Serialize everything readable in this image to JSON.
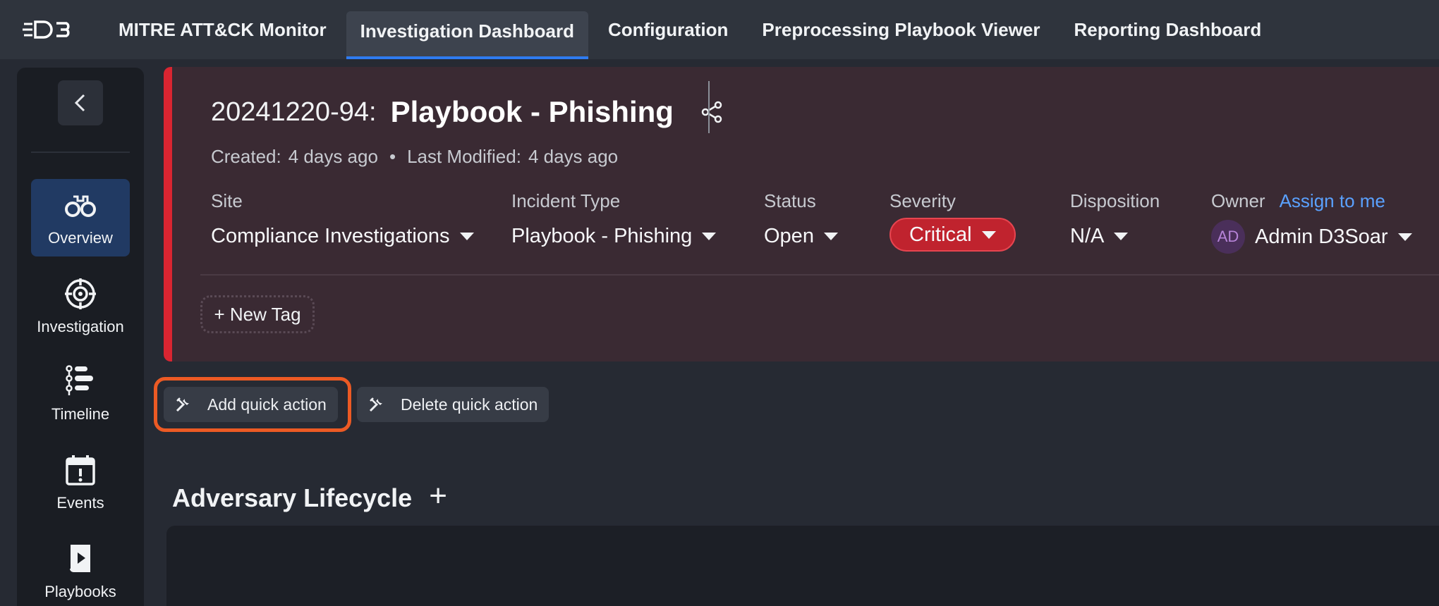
{
  "brand": {
    "logo_text": "D3"
  },
  "nav": {
    "tabs": [
      {
        "label": "MITRE ATT&CK Monitor"
      },
      {
        "label": "Investigation Dashboard",
        "active": true
      },
      {
        "label": "Configuration"
      },
      {
        "label": "Preprocessing Playbook Viewer"
      },
      {
        "label": "Reporting Dashboard"
      }
    ]
  },
  "sidebar": {
    "items": [
      {
        "label": "Overview",
        "icon": "binoculars-icon",
        "active": true
      },
      {
        "label": "Investigation",
        "icon": "crosshair-icon"
      },
      {
        "label": "Timeline",
        "icon": "timeline-icon"
      },
      {
        "label": "Events",
        "icon": "calendar-alert-icon"
      },
      {
        "label": "Playbooks",
        "icon": "playbook-icon"
      }
    ]
  },
  "incident": {
    "id": "20241220-94:",
    "title": "Playbook - Phishing",
    "created_label": "Created:",
    "created_value": "4 days ago",
    "separator": "•",
    "modified_label": "Last Modified:",
    "modified_value": "4 days ago",
    "fields": {
      "site": {
        "label": "Site",
        "value": "Compliance Investigations"
      },
      "incident_type": {
        "label": "Incident Type",
        "value": "Playbook - Phishing"
      },
      "status": {
        "label": "Status",
        "value": "Open"
      },
      "severity": {
        "label": "Severity",
        "value": "Critical"
      },
      "disposition": {
        "label": "Disposition",
        "value": "N/A"
      },
      "owner": {
        "label": "Owner",
        "assign_link": "Assign to me",
        "avatar_initials": "AD",
        "value": "Admin D3Soar"
      }
    },
    "new_tag_label": "+ New Tag"
  },
  "quick_actions": {
    "add_label": "Add quick action",
    "delete_label": "Delete quick action"
  },
  "section": {
    "title": "Adversary Lifecycle",
    "add_symbol": "+"
  },
  "colors": {
    "accent_blue": "#2f7bf0",
    "critical_red": "#c0232e",
    "incident_border": "#d92531",
    "highlight_orange": "#ec5a24",
    "link_blue": "#5aa1ff"
  }
}
